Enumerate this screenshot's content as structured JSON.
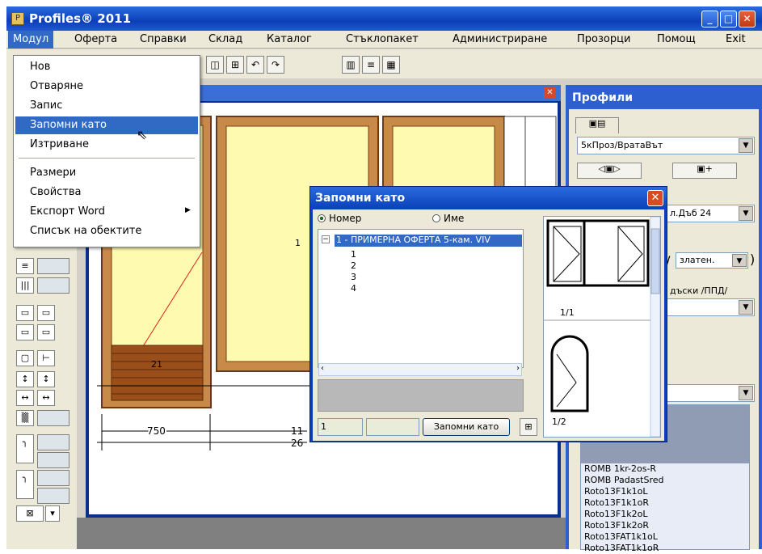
{
  "window": {
    "title": "Profiles® 2011"
  },
  "menubar": [
    "Модул",
    "Оферта",
    "Справки",
    "Склад",
    "Каталог",
    "Стъклопакет",
    "Администриране",
    "Прозорци",
    "Помощ",
    "Exit"
  ],
  "module_menu": {
    "items": [
      "Нов",
      "Отваряне",
      "Запис",
      "Запомни като",
      "Изтриване"
    ],
    "items2": [
      "Размери",
      "Свойства",
      "Експорт Word",
      "Списък на обектите"
    ],
    "highlighted": "Запомни като"
  },
  "canvas": {
    "dim_750": "750",
    "dim_11": "11",
    "dim_26": "26",
    "label_21": "21",
    "label_1": "1"
  },
  "right_panel": {
    "title": "Профили",
    "profile_combo": "5кПроз/ВратаВът",
    "combo2": "л.Дъб 24",
    "combo3": "златен.",
    "label_boards": "дъски /ППД/",
    "list": [
      "ROMB 1kr-2os-R",
      "ROMB PadastSred",
      "Roto13F1k1oL",
      "Roto13F1k1oR",
      "Roto13F1k2oL",
      "Roto13F1k2oR",
      "Roto13FAT1k1oL",
      "Roto13FAT1k1oR"
    ]
  },
  "dialog": {
    "title": "Запомни като",
    "radio_number": "Номер",
    "radio_name": "Име",
    "tree_root": "1 - ПРИМЕРНА ОФЕРТА 5-кам. VIV",
    "tree_children": [
      "1",
      "2",
      "3",
      "4"
    ],
    "number_field": "1",
    "save_button": "Запомни като",
    "preview1_label": "1/1",
    "preview2_label": "1/2"
  }
}
